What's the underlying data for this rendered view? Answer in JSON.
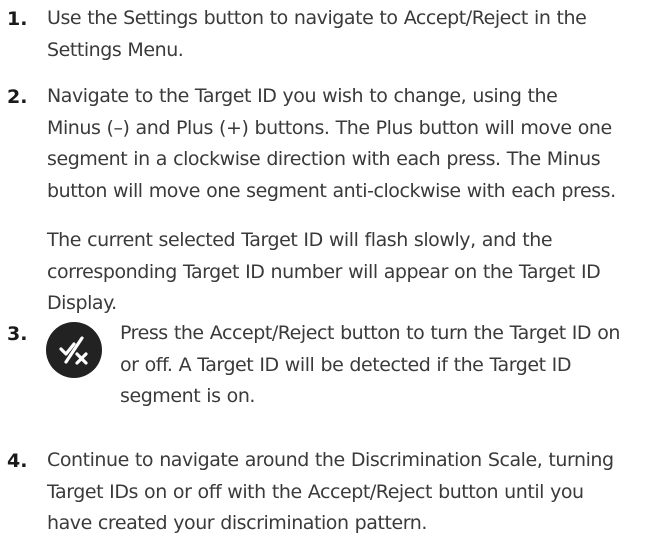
{
  "steps": [
    {
      "number": "1.",
      "lines": [
        "Use the Settings button to navigate to Accept/Reject in the",
        "Settings Menu."
      ]
    },
    {
      "number": "2.",
      "lines": [
        "Navigate to the Target ID you wish to change, using the",
        "Minus (–) and Plus (+) buttons. The Plus button will move one",
        "segment in a clockwise direction with each press. The Minus",
        "button will move one segment anti-clockwise with each press."
      ],
      "extra_lines": [
        "The current selected Target ID will flash slowly, and the",
        "corresponding Target ID number will appear on the Target ID",
        "Display."
      ]
    },
    {
      "number": "3.",
      "icon": "accept-reject-icon",
      "lines": [
        "Press the Accept/Reject button to turn the Target ID on",
        "or off. A Target ID will be detected if the Target ID",
        "segment is on."
      ]
    },
    {
      "number": "4.",
      "lines": [
        "Continue to navigate around the Discrimination Scale, turning",
        "Target IDs on or off with the Accept/Reject button until you",
        "have created your discrimination pattern."
      ]
    }
  ],
  "colors": {
    "text": "#3a3a3a",
    "number": "#1a1a1a",
    "icon_bg": "#222222",
    "icon_fg": "#ffffff"
  }
}
